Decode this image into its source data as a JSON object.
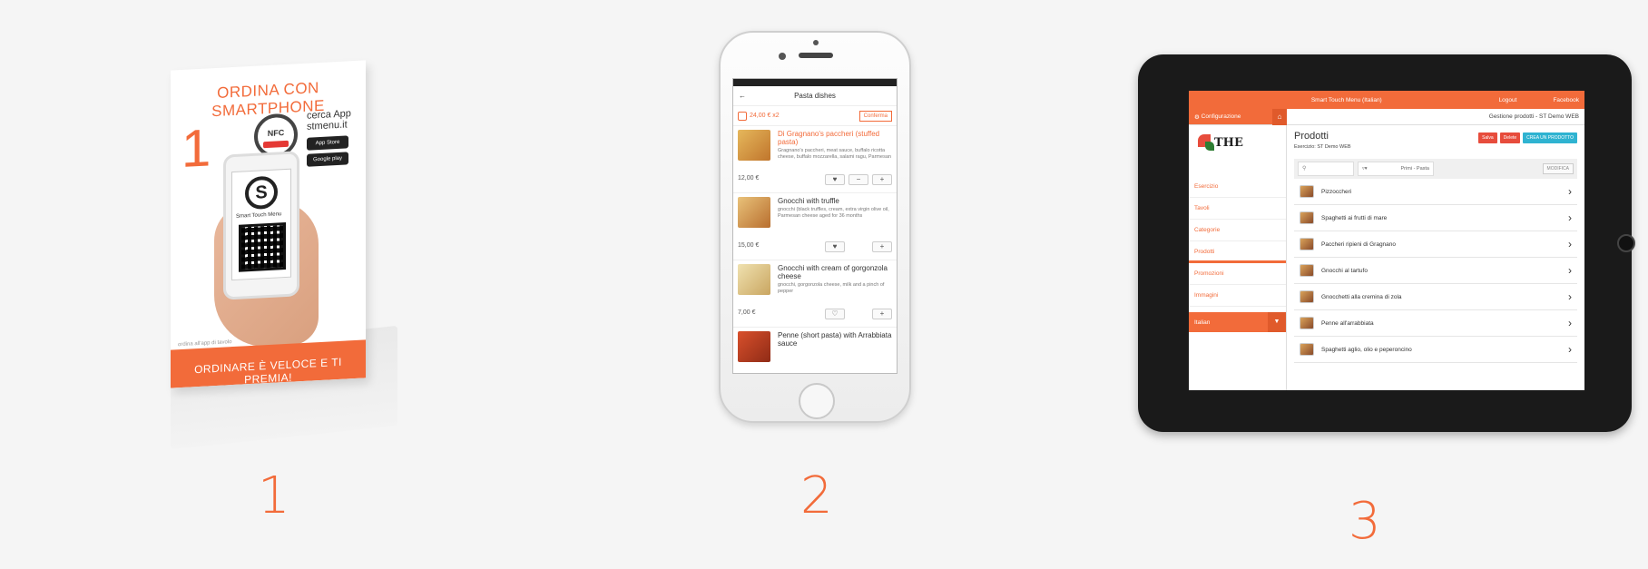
{
  "stand": {
    "title": "ORDINA CON SMARTPHONE",
    "number": "1",
    "nfc_label": "NFC",
    "app_line1": "cerca App",
    "app_line2": "stmenu.it",
    "app_store": "App Store",
    "google_play": "Google play",
    "brand": "Smart Touch Menu",
    "bottom_text": "ORDINARE È VELOCE E TI PREMIA!",
    "small_text": "ordina all'app di tavolo"
  },
  "phone": {
    "header_title": "Pasta dishes",
    "cart_amount": "24,00 € x2",
    "confirm_label": "Conferma",
    "dishes": [
      {
        "name": "Di Gragnano's paccheri (stuffed pasta)",
        "desc": "Gragnano's paccheri, meat sauce, buffalo ricotta cheese, buffalo mozzarella, salami ragu, Parmesan",
        "price": "12,00 €",
        "selected": true
      },
      {
        "name": "Gnocchi with truffle",
        "desc": "gnocchi (black truffles, cream, extra virgin olive oil, Parmesan cheese aged for 36 months",
        "price": "15,00 €",
        "selected": false
      },
      {
        "name": "Gnocchi with cream of gorgonzola cheese",
        "desc": "gnocchi, gorgonzola cheese, milk and a pinch of pepper",
        "price": "7,00 €",
        "selected": false
      },
      {
        "name": "Penne (short pasta) with Arrabbiata sauce",
        "desc": "",
        "price": "",
        "selected": false
      }
    ]
  },
  "tablet": {
    "app_title": "Smart Touch Menu (Italian)",
    "logout": "Logout",
    "facebook": "Facebook",
    "config_label": "Configurazione",
    "breadcrumb": "Gestione prodotti - ST Demo WEB",
    "logo_text": "THE",
    "sidebar": [
      "Esercizio",
      "Tavoli",
      "Categorie",
      "Prodotti",
      "Promozioni",
      "Immagini"
    ],
    "language": "Italian",
    "page_title": "Prodotti",
    "page_sub": "Esercizio: ST Demo WEB",
    "btn_save": "Salva",
    "btn_delete": "Delete",
    "btn_create": "CREA UN PRODOTTO",
    "search_placeholder": "Cerca",
    "filter_value": "Primi - Pasta",
    "modify": "MODIFICA",
    "products": [
      "Pizzoccheri",
      "Spaghetti ai frutti di mare",
      "Paccheri ripieni di Gragnano",
      "Gnocchi al tartufo",
      "Gnocchetti alla cremina di zola",
      "Penne all'arrabbiata",
      "Spaghetti aglio, olio e peperoncino"
    ]
  },
  "steps": [
    "1",
    "2",
    "3"
  ],
  "colors": {
    "accent": "#f26b3a",
    "background": "#f5f5f5"
  }
}
